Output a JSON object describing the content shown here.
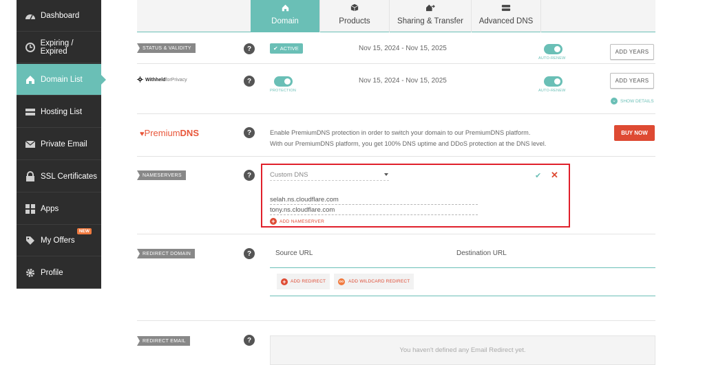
{
  "sidebar": {
    "items": [
      {
        "label": "Dashboard",
        "icon": "dashboard-gauge-icon"
      },
      {
        "label": "Expiring / Expired",
        "icon": "clock-history-icon"
      },
      {
        "label": "Domain List",
        "icon": "home-icon",
        "active": true
      },
      {
        "label": "Hosting List",
        "icon": "server-icon"
      },
      {
        "label": "Private Email",
        "icon": "envelope-icon"
      },
      {
        "label": "SSL Certificates",
        "icon": "lock-icon"
      },
      {
        "label": "Apps",
        "icon": "apps-grid-icon"
      },
      {
        "label": "My Offers",
        "icon": "tag-icon",
        "badge": "NEW"
      },
      {
        "label": "Profile",
        "icon": "gear-icon"
      }
    ]
  },
  "tabs": [
    {
      "label": "Domain",
      "icon": "home-icon",
      "active": true
    },
    {
      "label": "Products",
      "icon": "box-icon"
    },
    {
      "label": "Sharing & Transfer",
      "icon": "share-transfer-icon"
    },
    {
      "label": "Advanced DNS",
      "icon": "dns-server-icon"
    }
  ],
  "status_row": {
    "tag": "STATUS & VALIDITY",
    "help": "?",
    "badge": "ACTIVE",
    "dates": "Nov 15, 2024 - Nov 15, 2025",
    "auto_renew": "AUTO-RENEW",
    "auto_renew_on": true,
    "button": "ADD YEARS"
  },
  "privacy_row": {
    "logo_bold": "Withheld",
    "logo_light": "forPrivacy",
    "help": "?",
    "protection": "PROTECTION",
    "protection_on": true,
    "dates": "Nov 15, 2024 - Nov 15, 2025",
    "auto_renew": "AUTO-RENEW",
    "auto_renew_on": true,
    "button": "ADD YEARS",
    "show_details": "SHOW DETAILS"
  },
  "premium_row": {
    "logo_light": "Premium",
    "logo_bold": "DNS",
    "help": "?",
    "line1": "Enable PremiumDNS protection in order to switch your domain to our PremiumDNS platform.",
    "line2": "With our PremiumDNS platform, you get 100% DNS uptime and DDoS protection at the DNS level.",
    "button": "BUY NOW"
  },
  "nameservers": {
    "tag": "NAMESERVERS",
    "help": "?",
    "selected": "Custom DNS",
    "entries": [
      "selah.ns.cloudflare.com",
      "tony.ns.cloudflare.com"
    ],
    "add_label": "ADD NAMESERVER",
    "highlight_color": "#e01f2a"
  },
  "redirect_domain": {
    "tag": "REDIRECT DOMAIN",
    "help": "?",
    "source_header": "Source URL",
    "destination_header": "Destination URL",
    "add_redirect": "ADD REDIRECT",
    "add_wildcard": "ADD WILDCARD REDIRECT"
  },
  "redirect_email": {
    "tag": "REDIRECT EMAIL",
    "help": "?",
    "empty_text": "You haven't defined any Email Redirect yet."
  },
  "colors": {
    "accent": "#6abfb6",
    "danger": "#de4a33",
    "sidebar": "#2d2d2d"
  }
}
